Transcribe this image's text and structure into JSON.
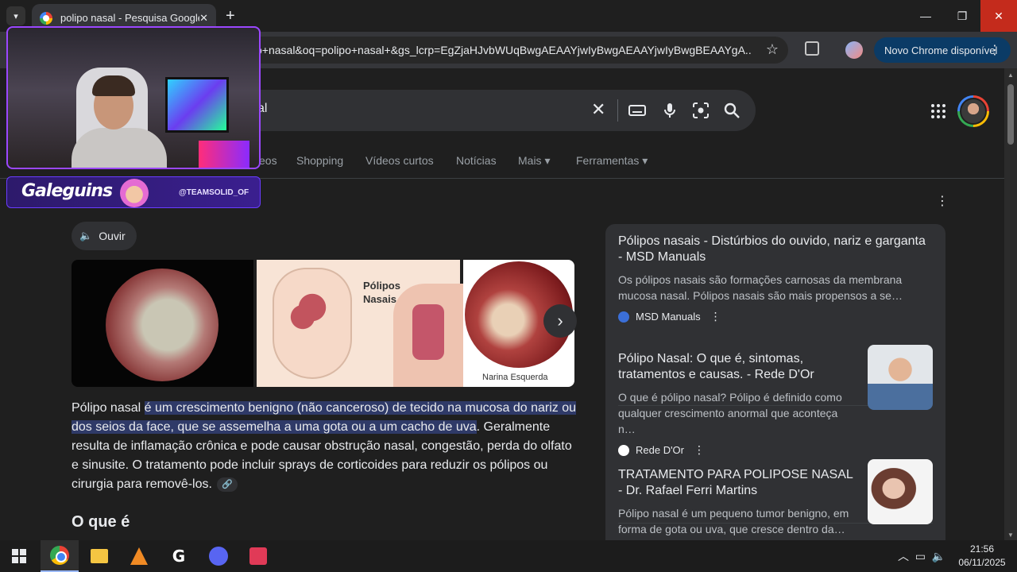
{
  "tab": {
    "title": "polipo nasal - Pesquisa Google",
    "close": "✕"
  },
  "window": {
    "minimize": "—",
    "maximize": "❐",
    "close": "✕"
  },
  "toolbar": {
    "url": "o+nasal&oq=polipo+nasal+&gs_lcrp=EgZjaHJvbWUqBwgAEAAYjwIyBwgAEAAYjwIyBwgBEAAYgA...",
    "update_label": "Novo Chrome disponível"
  },
  "search": {
    "query_visible": "al"
  },
  "nav": {
    "tabs": [
      "eos",
      "Shopping",
      "Vídeos curtos",
      "Notícias",
      "Mais ▾",
      "Ferramentas ▾"
    ]
  },
  "listen_label": "Ouvir",
  "images": [
    {
      "caption": ""
    },
    {
      "caption": "Pólipos Nasais"
    },
    {
      "caption": "Narina Esquerda"
    }
  ],
  "answer": {
    "lead": "Pólipo nasal ",
    "highlight": "é um crescimento benigno (não canceroso) de tecido na mucosa do nariz ou dos seios da face, que se assemelha a uma gota ou a um cacho de uva",
    "rest": ". Geralmente resulta de inflamação crônica e pode causar obstrução nasal, congestão, perda do olfato e sinusite. O tratamento pode incluir sprays de corticoides para reduzir os pólipos ou cirurgia para removê-los."
  },
  "heading": "O que é",
  "sources": [
    {
      "title": "Pólipos nasais - Distúrbios do ouvido, nariz e garganta - MSD Manuals",
      "desc": "Os pólipos nasais são formações carnosas da membrana mucosa nasal. Pólipos nasais são mais propensos a se…",
      "site": "MSD Manuals"
    },
    {
      "title": "Pólipo Nasal: O que é, sintomas, tratamentos e causas. - Rede D'Or",
      "desc": "O que é pólipo nasal? Pólipo é definido como qualquer crescimento anormal que aconteça n…",
      "site": "Rede D'Or"
    },
    {
      "title": "TRATAMENTO PARA POLIPOSE NASAL - Dr. Rafael Ferri Martins",
      "desc": "Pólipo nasal é um pequeno tumor benigno, em forma de gota ou uva, que cresce dentro da…",
      "site": ""
    }
  ],
  "overlay": {
    "brand": "Galeguins",
    "handle": "@TEAMSOLID_OF"
  },
  "clock": {
    "time": "21:56",
    "date": "06/11/2025"
  },
  "colors": {
    "highlight": "#2f3a68",
    "close_button": "#c42b1c",
    "update_button": "#0b3b66"
  }
}
